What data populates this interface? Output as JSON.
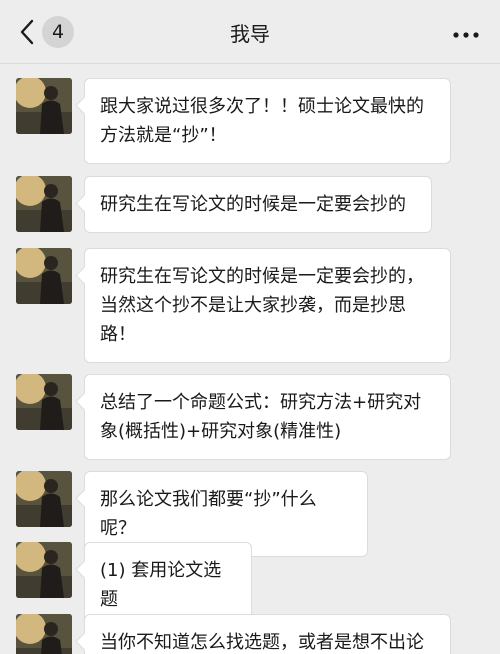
{
  "header": {
    "back_icon": "chevron-left-icon",
    "unread_count": "4",
    "title": "我导",
    "more_icon": "ellipsis-icon"
  },
  "contact": {
    "avatar": "person-photo-avatar"
  },
  "messages": [
    {
      "text": "跟大家说过很多次了！！硕士论文最快的方法就是“抄”！"
    },
    {
      "text": "研究生在写论文的时候是一定要会抄的"
    },
    {
      "text": "研究生在写论文的时候是一定要会抄的，当然这个抄不是让大家抄袭，而是抄思路！"
    },
    {
      "text": "总结了一个命题公式：研究方法+研究对象(概括性)+研究对象(精准性)"
    },
    {
      "text": "那么论文我们都要“抄”什么呢？"
    },
    {
      "text": "(1) 套用论文选题"
    },
    {
      "text": "当你不知道怎么找选题，或者是想不出论"
    }
  ]
}
